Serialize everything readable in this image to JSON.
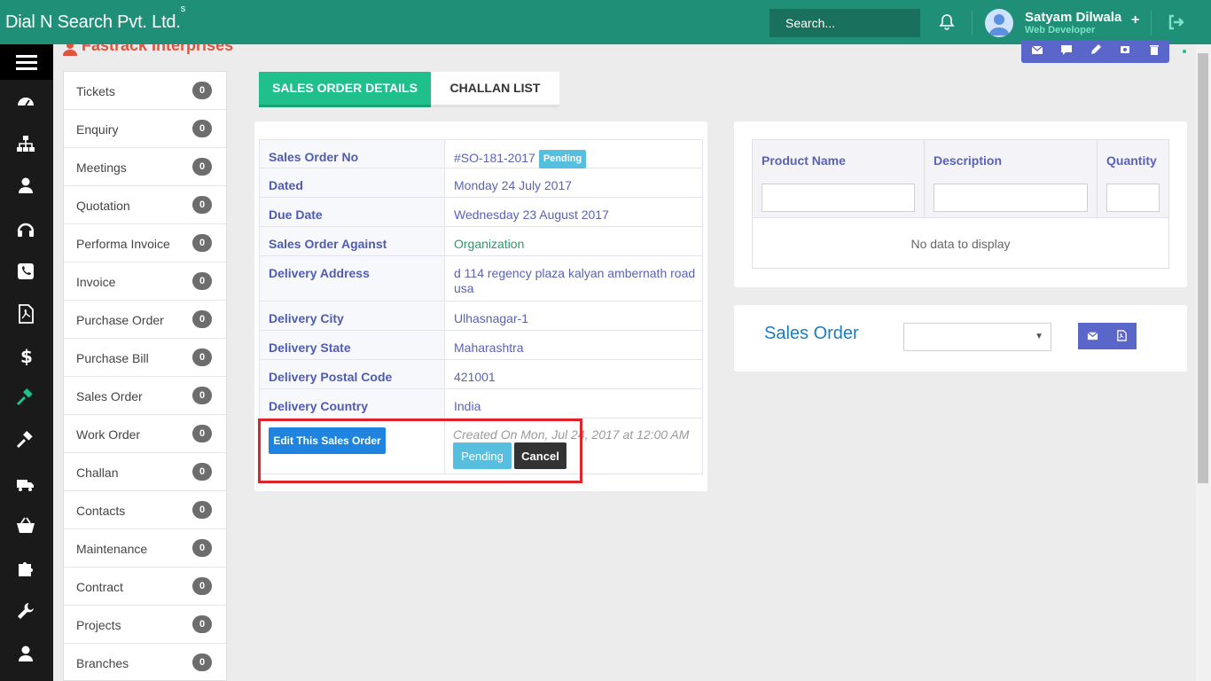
{
  "header": {
    "brand": "Dial N Search Pvt. Ltd.",
    "brand_sup": "s",
    "search_placeholder": "Search...",
    "user_name": "Satyam Dilwala",
    "user_role": "Web Developer",
    "plus_label": "+"
  },
  "entity": {
    "name": "Fastrack Interprises"
  },
  "rail_icons": [
    "dashboard-icon",
    "org-chart-icon",
    "user-icon",
    "headset-icon",
    "phone-icon",
    "pdf-icon",
    "dollar-icon",
    "gavel-icon",
    "gavel-icon",
    "truck-icon",
    "basket-icon",
    "puzzle-icon",
    "wrench-icon",
    "user-icon"
  ],
  "modules": [
    {
      "label": "Tickets",
      "count": "0"
    },
    {
      "label": "Enquiry",
      "count": "0"
    },
    {
      "label": "Meetings",
      "count": "0"
    },
    {
      "label": "Quotation",
      "count": "0"
    },
    {
      "label": "Performa Invoice",
      "count": "0"
    },
    {
      "label": "Invoice",
      "count": "0"
    },
    {
      "label": "Purchase Order",
      "count": "0"
    },
    {
      "label": "Purchase Bill",
      "count": "0"
    },
    {
      "label": "Sales Order",
      "count": "0"
    },
    {
      "label": "Work Order",
      "count": "0"
    },
    {
      "label": "Challan",
      "count": "0"
    },
    {
      "label": "Contacts",
      "count": "0"
    },
    {
      "label": "Maintenance",
      "count": "0"
    },
    {
      "label": "Contract",
      "count": "0"
    },
    {
      "label": "Projects",
      "count": "0"
    },
    {
      "label": "Branches",
      "count": "0"
    }
  ],
  "tabs": {
    "details": "SALES ORDER DETAILS",
    "challan": "CHALLAN LIST"
  },
  "details": {
    "rows": [
      {
        "key": "Sales Order No",
        "value": "#SO-181-2017",
        "badge": "Pending"
      },
      {
        "key": "Dated",
        "value": "Monday 24 July 2017"
      },
      {
        "key": "Due Date",
        "value": "Wednesday 23 August 2017"
      },
      {
        "key": "Sales Order Against",
        "value": "Organization"
      },
      {
        "key": "Delivery Address",
        "value": "d 114 regency plaza kalyan ambernath road usa"
      },
      {
        "key": "Delivery City",
        "value": "Ulhasnagar-1"
      },
      {
        "key": "Delivery State",
        "value": "Maharashtra"
      },
      {
        "key": "Delivery Postal Code",
        "value": "421001"
      },
      {
        "key": "Delivery Country",
        "value": "India"
      }
    ],
    "edit_button": "Edit This Sales Order",
    "created_text": "Created On Mon, Jul 24, 2017 at 12:00 AM",
    "pending_button": "Pending",
    "cancel_button": "Cancel"
  },
  "products": {
    "columns": [
      "Product Name",
      "Description",
      "Quantity"
    ],
    "empty_text": "No data to display"
  },
  "sales_order_panel": {
    "title": "Sales Order",
    "select_value": ""
  },
  "colors": {
    "header": "#1f8f77",
    "accent_green": "#1fc08b",
    "primary_blue": "#1f84e0",
    "toolbar_purple": "#5a66c9",
    "highlight_red": "#e0222a"
  }
}
